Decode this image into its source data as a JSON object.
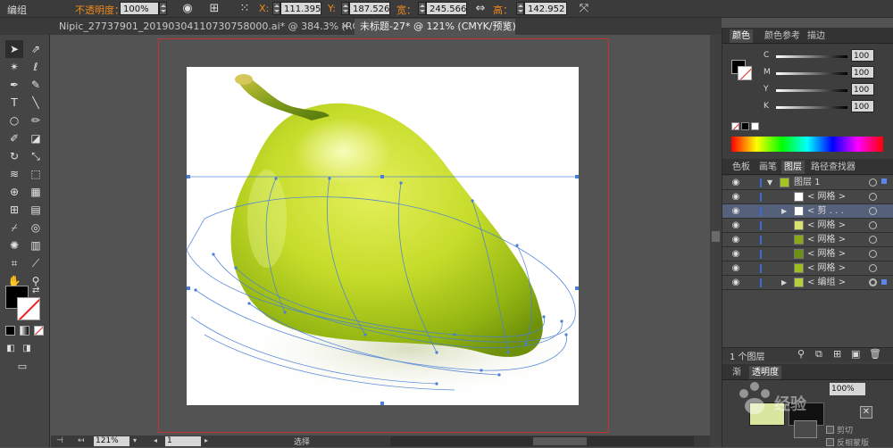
{
  "control_bar": {
    "selection_label": "编组",
    "opacity_label": "不透明度：",
    "opacity_value": "100%",
    "x_label": "X:",
    "x_value": "111.395",
    "y_label": "Y:",
    "y_value": "187.526",
    "w_label": "宽：",
    "w_value": "245.566",
    "h_label": "高：",
    "h_value": "142.952"
  },
  "document_tabs": [
    {
      "label": "Nipic_27737901_20190304110730758000.ai* @ 384.3% (RGB/预览)",
      "active": false
    },
    {
      "label": "未标题-27* @ 121% (CMYK/预览)",
      "active": true
    }
  ],
  "color_panel": {
    "tabs": [
      "颜色",
      "颜色参考",
      "描边"
    ],
    "channels": [
      {
        "label": "C",
        "value": "100"
      },
      {
        "label": "M",
        "value": "100"
      },
      {
        "label": "Y",
        "value": "100"
      },
      {
        "label": "K",
        "value": "100"
      }
    ]
  },
  "layers_panel": {
    "tabs": [
      "色板",
      "画笔",
      "图层",
      "路径查找器"
    ],
    "rows": [
      {
        "label": "图层 1",
        "indent": 0
      },
      {
        "label": "< 网格 >",
        "indent": 1
      },
      {
        "label": "< 剪 . . .",
        "indent": 1
      },
      {
        "label": "< 网格 >",
        "indent": 1
      },
      {
        "label": "< 网格 >",
        "indent": 1
      },
      {
        "label": "< 网格 >",
        "indent": 1
      },
      {
        "label": "< 网格 >",
        "indent": 1
      },
      {
        "label": "< 编组 >",
        "indent": 1
      }
    ],
    "footer_count": "1 个图层"
  },
  "bottom_panel": {
    "tabs": [
      "渐",
      "透明度"
    ],
    "opacity_value": "100%",
    "clip_label": "剪切",
    "invert_mask_label": "反相蒙版"
  },
  "status_bar": {
    "zoom_value": "121%",
    "page_value": "1",
    "tool_label": "选择"
  },
  "watermark": "Baidu经验",
  "colors": {
    "accent": "#f08a1c",
    "selection": "#4a7fd8",
    "artboard_border": "#c33333"
  }
}
